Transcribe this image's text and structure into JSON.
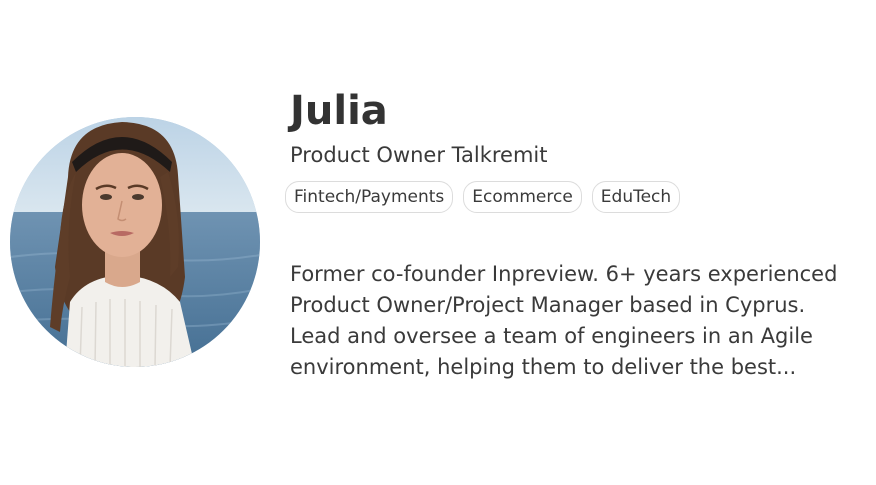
{
  "profile": {
    "name": "Julia",
    "role": "Product Owner Talkremit",
    "tags": [
      "Fintech/Payments",
      "Ecommerce",
      "EduTech"
    ],
    "bio": "Former co-founder Inpreview. 6+ years experienced Product Owner/Project Manager based in Cyprus. Lead and oversee a team of engineers in an Agile environment, helping them to deliver the best..."
  },
  "colors": {
    "text": "#333333",
    "tag_border": "#dcdcdc",
    "background": "#ffffff"
  }
}
